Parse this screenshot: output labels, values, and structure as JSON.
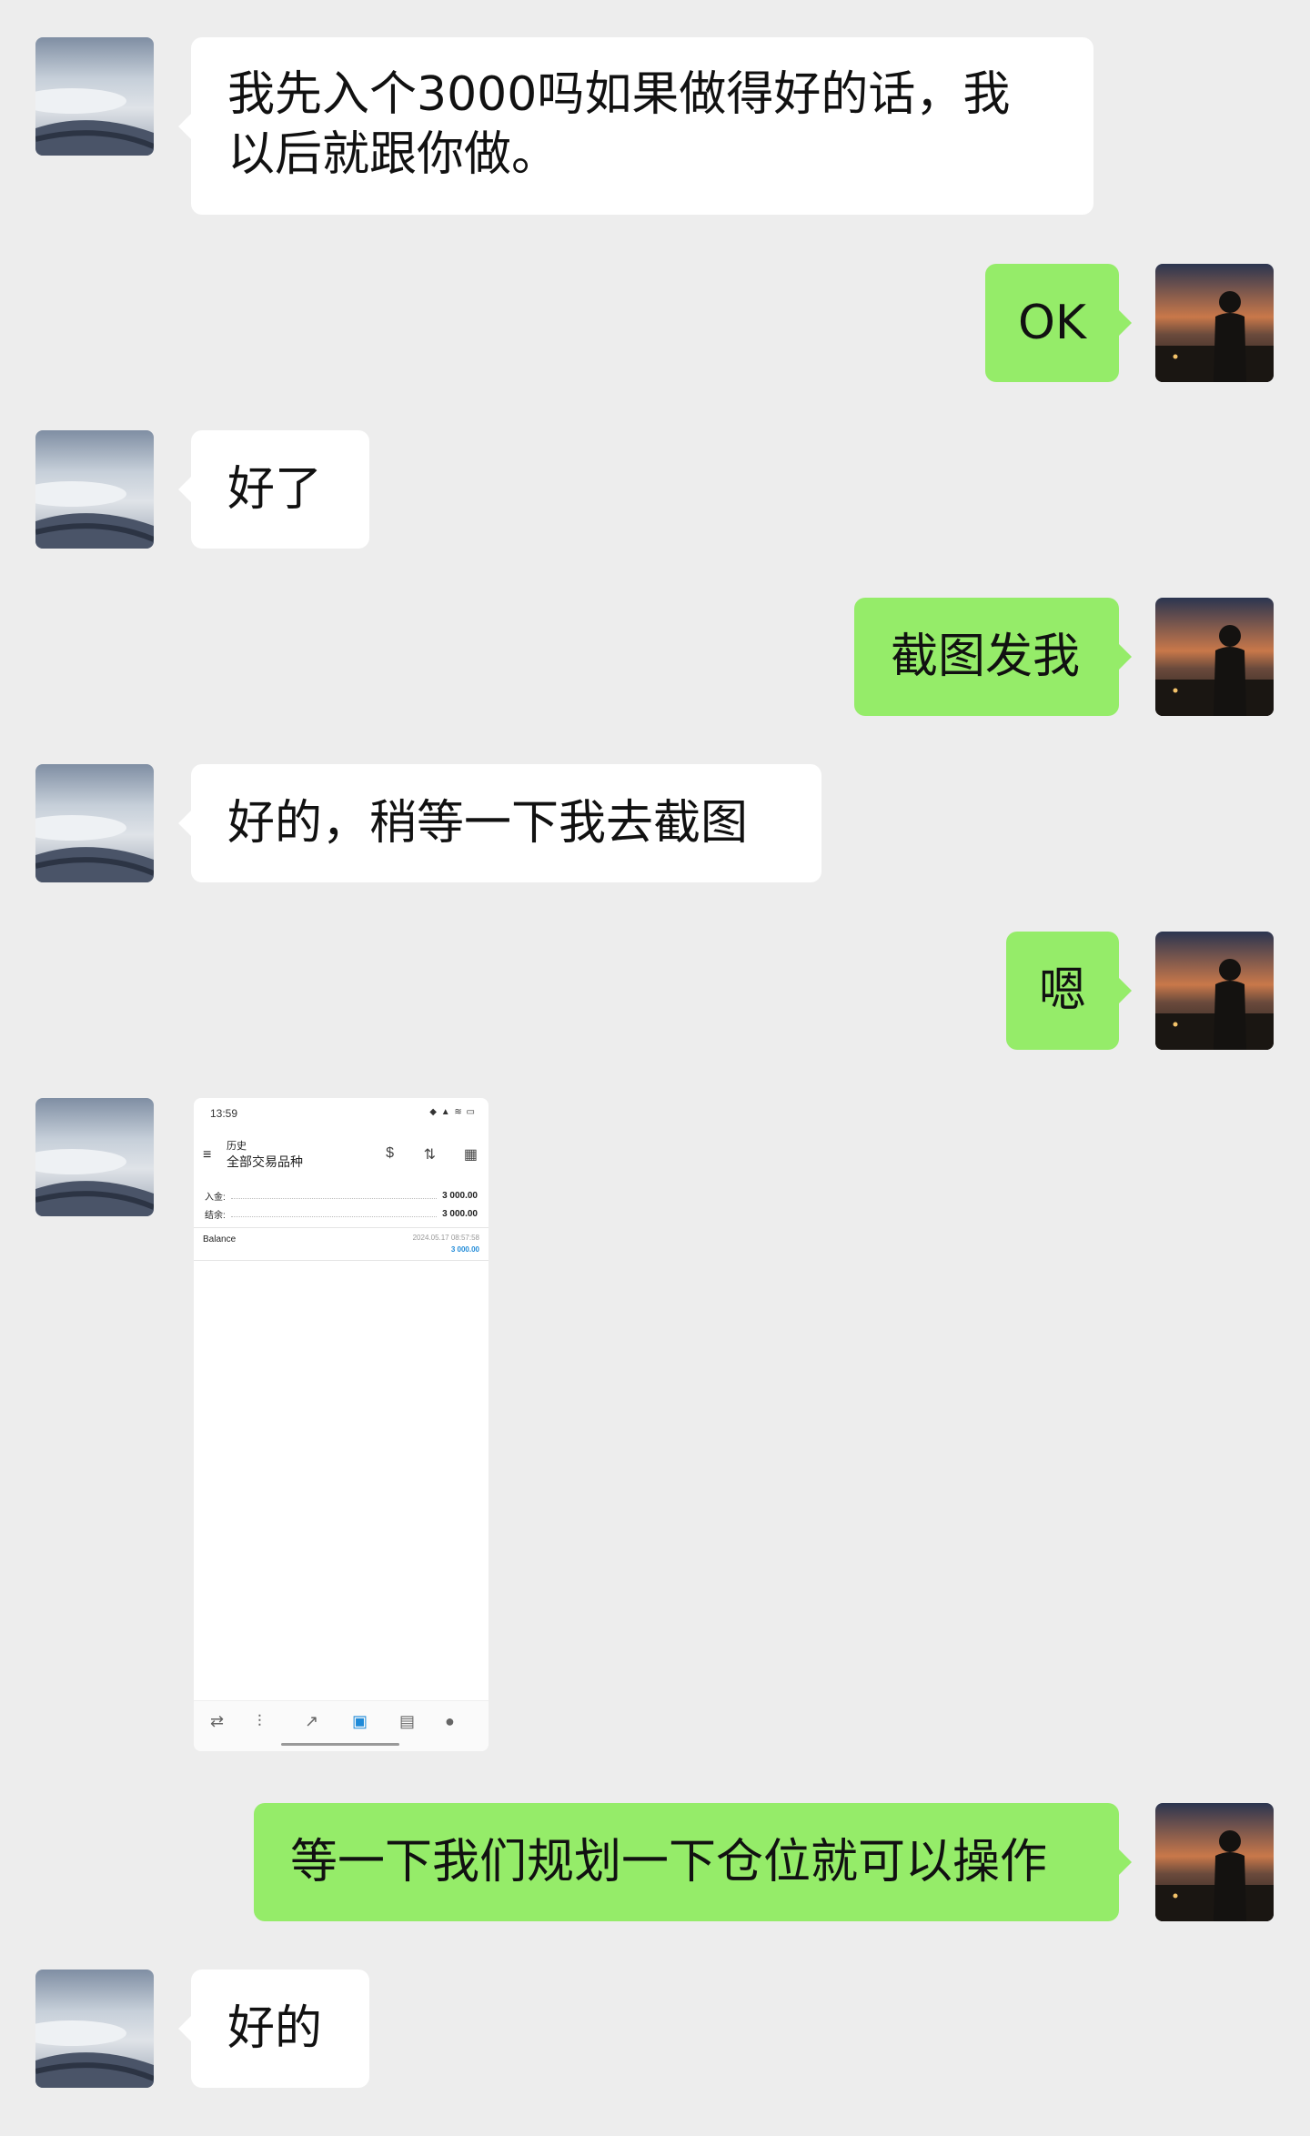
{
  "messages": [
    {
      "side": "in",
      "text": "我先入个3000吗如果做得好的话，我以后就跟你做。"
    },
    {
      "side": "out",
      "text": "OK"
    },
    {
      "side": "in",
      "text": "好了"
    },
    {
      "side": "out",
      "text": "截图发我"
    },
    {
      "side": "in",
      "text": "好的，稍等一下我去截图"
    },
    {
      "side": "out",
      "text": "嗯"
    },
    {
      "side": "out",
      "text": "等一下我们规划一下仓位就可以操作"
    },
    {
      "side": "in",
      "text": "好的"
    }
  ],
  "screenshot": {
    "time": "13:59",
    "status_icons": "◆ ▲ ≋ ▭",
    "header_title": "历史",
    "header_subtitle": "全部交易品种",
    "rows": [
      {
        "label": "入金:",
        "value": "3 000.00"
      },
      {
        "label": "结余:",
        "value": "3 000.00"
      }
    ],
    "balance_label": "Balance",
    "balance_time": "2024.05.17 08:57:58",
    "balance_value": "3 000.00"
  },
  "icons": {
    "menu": "hamburger-icon",
    "deposit": "dollar-swap-icon",
    "sort": "sort-icon",
    "calendar": "calendar-icon"
  }
}
